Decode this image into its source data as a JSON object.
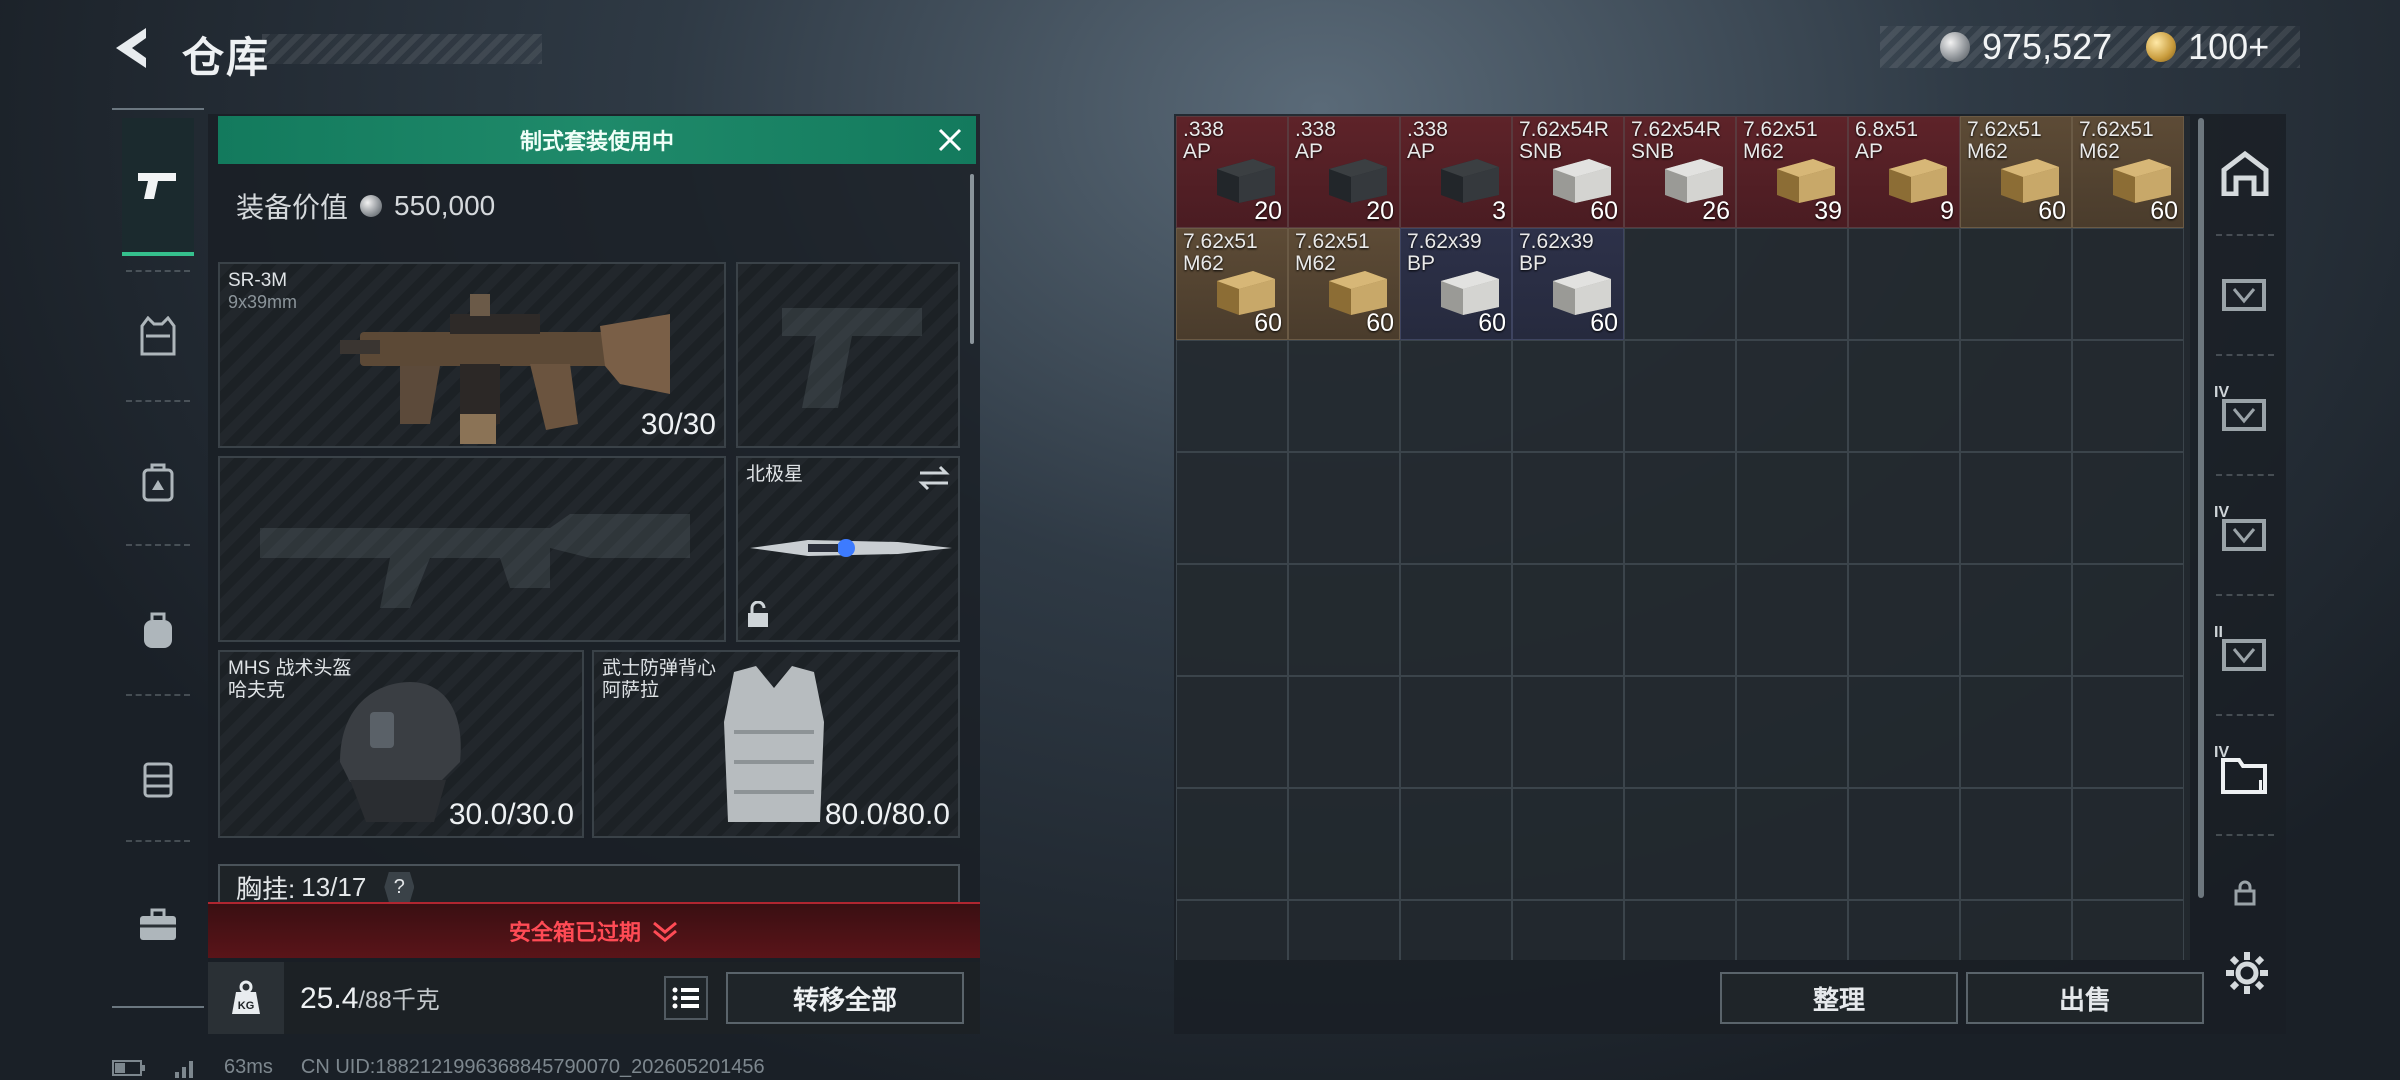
{
  "header": {
    "title": "仓库"
  },
  "currency": {
    "silver": "975,527",
    "gold": "100+"
  },
  "kit_banner": {
    "text": "制式套装使用中"
  },
  "equipment": {
    "value_label": "装备价值",
    "value": "550,000",
    "primary": {
      "name": "SR-3M",
      "caliber": "9x39mm",
      "ammo": "30/30"
    },
    "melee": {
      "name": "北极星"
    },
    "helmet": {
      "line1": "MHS 战术头盔",
      "line2": "哈夫克",
      "durability": "30.0/30.0"
    },
    "armor": {
      "line1": "武士防弹背心",
      "line2": "阿萨拉",
      "durability": "80.0/80.0"
    },
    "chest_rig": {
      "label": "胸挂:",
      "capacity": "13/17",
      "help": "?"
    }
  },
  "safe_box": {
    "text": "安全箱已过期"
  },
  "weight": {
    "current": "25.4",
    "max": "/88千克",
    "icon": "KG"
  },
  "buttons": {
    "transfer_all": "转移全部",
    "sort": "整理",
    "sell": "出售"
  },
  "stash_items": [
    {
      "line1": ".338",
      "line2": "AP",
      "qty": "20",
      "tone": "red",
      "box": "dark"
    },
    {
      "line1": ".338",
      "line2": "AP",
      "qty": "20",
      "tone": "red",
      "box": "dark"
    },
    {
      "line1": ".338",
      "line2": "AP",
      "qty": "3",
      "tone": "red",
      "box": "dark"
    },
    {
      "line1": "7.62x54R",
      "line2": "SNB",
      "qty": "60",
      "tone": "red",
      "box": "white"
    },
    {
      "line1": "7.62x54R",
      "line2": "SNB",
      "qty": "26",
      "tone": "red",
      "box": "white"
    },
    {
      "line1": "7.62x51",
      "line2": "M62",
      "qty": "39",
      "tone": "red",
      "box": "tan"
    },
    {
      "line1": "6.8x51",
      "line2": "AP",
      "qty": "9",
      "tone": "red",
      "box": "tan"
    },
    {
      "line1": "7.62x51",
      "line2": "M62",
      "qty": "60",
      "tone": "tan",
      "box": "tan"
    },
    {
      "line1": "7.62x51",
      "line2": "M62",
      "qty": "60",
      "tone": "tan",
      "box": "tan"
    },
    {
      "line1": "7.62x51",
      "line2": "M62",
      "qty": "60",
      "tone": "tan",
      "box": "tan"
    },
    {
      "line1": "7.62x51",
      "line2": "M62",
      "qty": "60",
      "tone": "tan",
      "box": "tan"
    },
    {
      "line1": "7.62x39",
      "line2": "BP",
      "qty": "60",
      "tone": "blue",
      "box": "white"
    },
    {
      "line1": "7.62x39",
      "line2": "BP",
      "qty": "60",
      "tone": "blue",
      "box": "white"
    }
  ],
  "right_nav": [
    {
      "icon": "home-icon",
      "tier": ""
    },
    {
      "icon": "container-icon",
      "tier": ""
    },
    {
      "icon": "container-icon",
      "tier": "IV"
    },
    {
      "icon": "container-icon",
      "tier": "IV"
    },
    {
      "icon": "container-icon",
      "tier": "II"
    },
    {
      "icon": "folder-icon",
      "tier": "IV"
    },
    {
      "icon": "lock-icon",
      "tier": ""
    }
  ],
  "footer": {
    "ping": "63ms",
    "uid": "CN UID:1882121996368845790070_202605201456"
  },
  "colors": {
    "accent_green": "#1f8a6a",
    "alert_red": "#ff4b55"
  }
}
